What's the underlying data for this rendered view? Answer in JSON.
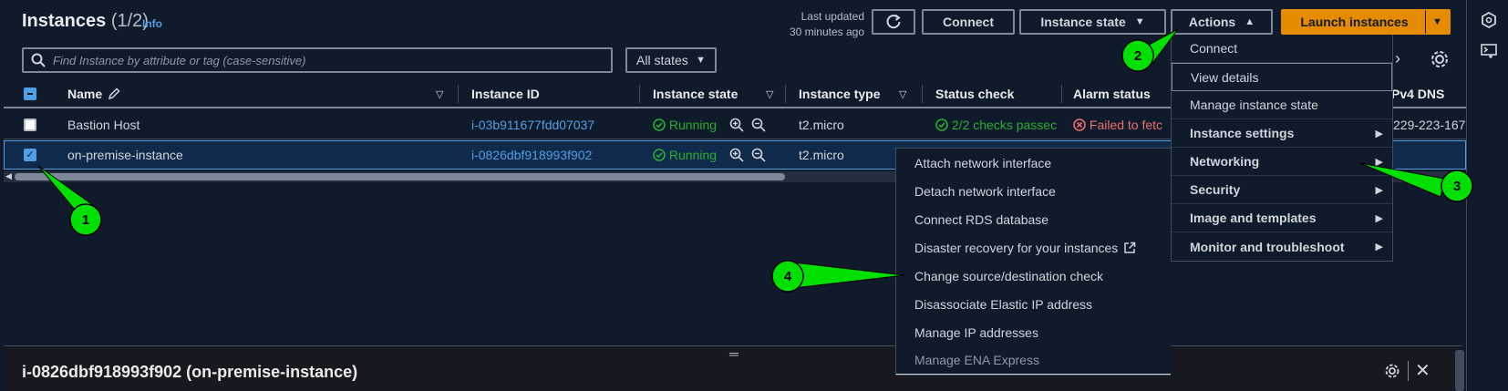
{
  "header": {
    "title": "Instances",
    "count": "(1/2)",
    "info": "Info",
    "last_updated_line1": "Last updated",
    "last_updated_line2": "30 minutes ago",
    "connect": "Connect",
    "instance_state": "Instance state",
    "actions": "Actions",
    "launch": "Launch instances"
  },
  "search": {
    "placeholder": "Find Instance by attribute or tag (case-sensitive)",
    "states_filter": "All states"
  },
  "table": {
    "columns": [
      "Name",
      "Instance ID",
      "Instance state",
      "Instance type",
      "Status check",
      "Alarm status",
      "Pv4 DNS"
    ],
    "rows": [
      {
        "name": "Bastion Host",
        "id": "i-03b911677fdd07037",
        "state": "Running",
        "type": "t2.micro",
        "status": "2/2 checks passec",
        "alarm": "Failed to fetc",
        "dns": "229-223-167",
        "checked": false
      },
      {
        "name": "on-premise-instance",
        "id": "i-0826dbf918993f902",
        "state": "Running",
        "type": "t2.micro",
        "checked": true
      }
    ]
  },
  "actions_menu": {
    "items": [
      {
        "label": "Connect",
        "group": false
      },
      {
        "label": "View details",
        "group": false
      },
      {
        "label": "Manage instance state",
        "group": false
      },
      {
        "label": "Instance settings",
        "group": true
      },
      {
        "label": "Networking",
        "group": true
      },
      {
        "label": "Security",
        "group": true
      },
      {
        "label": "Image and templates",
        "group": true
      },
      {
        "label": "Monitor and troubleshoot",
        "group": true
      }
    ]
  },
  "networking_submenu": {
    "items": [
      "Attach network interface",
      "Detach network interface",
      "Connect RDS database",
      "Disaster recovery for your instances",
      "Change source/destination check",
      "Disassociate Elastic IP address",
      "Manage IP addresses",
      "Manage ENA Express"
    ]
  },
  "detail_panel": {
    "title": "i-0826dbf918993f902 (on-premise-instance)"
  },
  "callouts": [
    "1",
    "2",
    "3",
    "4"
  ],
  "colors": {
    "background": "#0f1b2a",
    "accent_orange": "#e68a00",
    "link_blue": "#539fe5",
    "running_green": "#29ad32",
    "error_red": "#eb6f6f",
    "callout_green": "#00e000"
  }
}
